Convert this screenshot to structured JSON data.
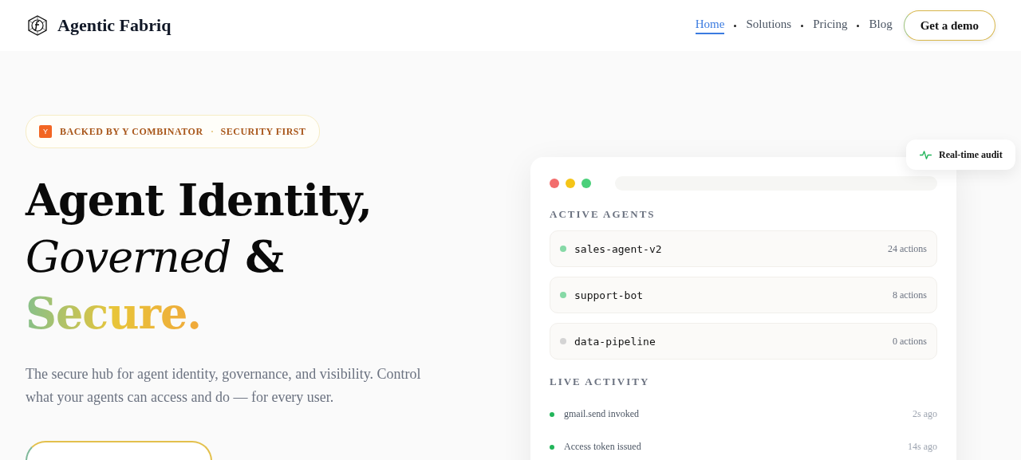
{
  "brand": {
    "name": "Agentic Fabriq"
  },
  "nav": {
    "items": [
      {
        "label": "Home",
        "selected": true
      },
      {
        "label": "Solutions",
        "selected": false
      },
      {
        "label": "Pricing",
        "selected": false
      },
      {
        "label": "Blog",
        "selected": false
      }
    ],
    "cta": "Get a demo"
  },
  "badge": {
    "logo_letter": "Y",
    "items": [
      "BACKED BY Y COMBINATOR",
      "SECURITY FIRST"
    ]
  },
  "headline": [
    [
      {
        "text": "Agent Identity,",
        "kind": "plain"
      }
    ],
    [
      {
        "text": "Governed",
        "kind": "italic"
      },
      {
        "text": "&",
        "kind": "plain"
      }
    ],
    [
      {
        "text": "Secure.",
        "kind": "gradient"
      }
    ]
  ],
  "subtitle": "The secure hub for agent identity, governance, and visibility. Control what your agents can access and do — for every user.",
  "audit_badge": {
    "label": "Real-time audit"
  },
  "panel": {
    "agents_title": "ACTIVE AGENTS",
    "agents": [
      {
        "name": "sales-agent-v2",
        "count": "24 actions",
        "color": "#86d9a6"
      },
      {
        "name": "support-bot",
        "count": "8 actions",
        "color": "#86d9a6"
      },
      {
        "name": "data-pipeline",
        "count": "0 actions",
        "color": "#d4d4d4"
      }
    ],
    "activity_title": "LIVE ACTIVITY",
    "activity": [
      {
        "text": "gmail.send invoked",
        "time": "2s ago"
      },
      {
        "text": "Access token issued",
        "time": "14s ago"
      }
    ]
  }
}
